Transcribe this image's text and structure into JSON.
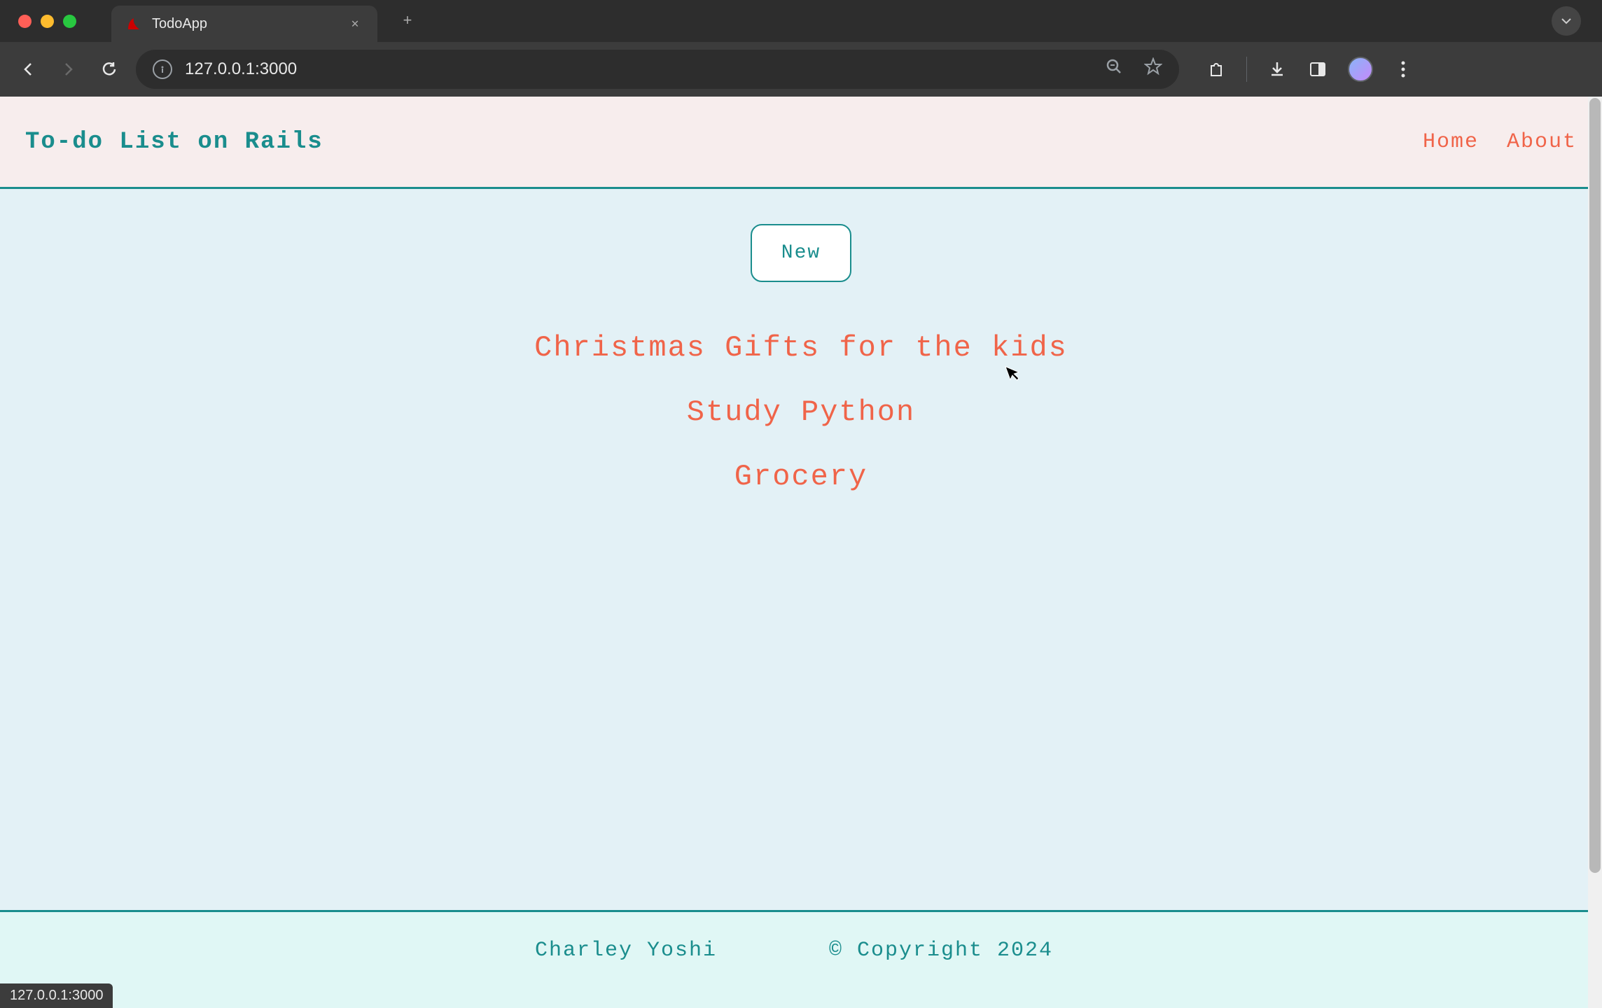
{
  "browser": {
    "tab_title": "TodoApp",
    "url": "127.0.0.1:3000",
    "status_bar": "127.0.0.1:3000"
  },
  "header": {
    "title": "To-do List on Rails",
    "nav": {
      "home": "Home",
      "about": "About"
    }
  },
  "main": {
    "new_button_label": "New",
    "todos": [
      "Christmas Gifts for the kids",
      "Study Python",
      "Grocery"
    ]
  },
  "footer": {
    "author": "Charley Yoshi",
    "copyright": "© Copyright 2024"
  }
}
